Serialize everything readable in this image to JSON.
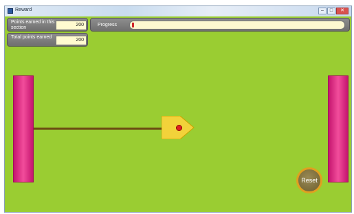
{
  "window": {
    "title": "Reward",
    "controls": [
      "–",
      "□",
      "✕"
    ]
  },
  "score": {
    "section_label": "Points earned in this section",
    "section_value": "200",
    "total_label": "Total points earned",
    "total_value": "200"
  },
  "progress": {
    "label": "Progress",
    "fraction": 0.01
  },
  "reset": {
    "label": "Reset"
  },
  "colors": {
    "background": "#9acd32",
    "wall": "#e8297f",
    "rod": "#6b4a12",
    "arrow": "#f2d23a",
    "dot": "#e02020"
  }
}
